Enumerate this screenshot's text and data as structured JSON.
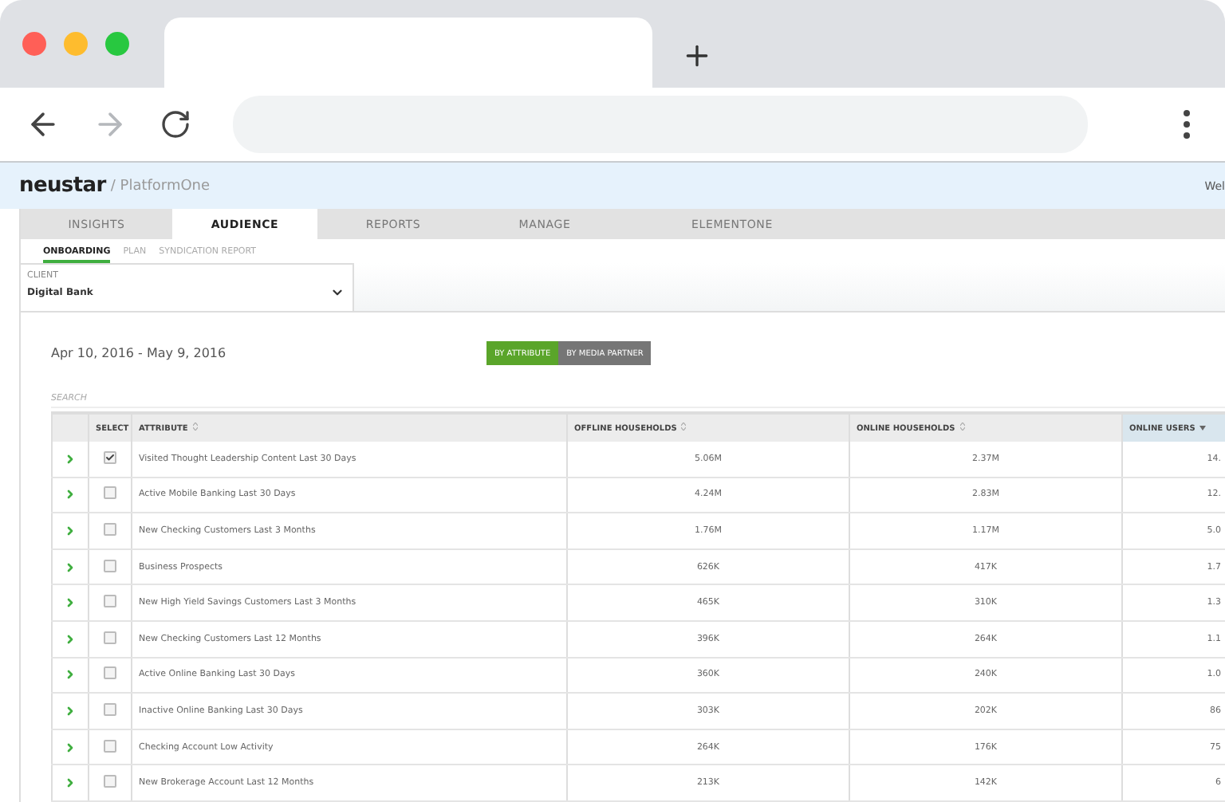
{
  "header": {
    "logo": "neustar",
    "product": "/ PlatformOne",
    "welcome": "Wel"
  },
  "tabs": [
    {
      "label": "INSIGHTS",
      "selected": false
    },
    {
      "label": "AUDIENCE",
      "selected": true
    },
    {
      "label": "REPORTS",
      "selected": false
    },
    {
      "label": "MANAGE",
      "selected": false
    },
    {
      "label": "ELEMENTONE",
      "selected": false
    }
  ],
  "subtabs": [
    {
      "label": "ONBOARDING",
      "selected": true
    },
    {
      "label": "PLAN",
      "selected": false
    },
    {
      "label": "SYNDICATION REPORT",
      "selected": false
    }
  ],
  "client": {
    "label": "CLIENT",
    "value": "Digital Bank"
  },
  "date_range": "Apr 10, 2016 - May 9, 2016",
  "view_toggle": [
    {
      "label": "BY ATTRIBUTE",
      "selected": true
    },
    {
      "label": "BY MEDIA PARTNER",
      "selected": false
    }
  ],
  "search": {
    "placeholder": "SEARCH"
  },
  "table": {
    "columns": [
      {
        "label": "SELECT",
        "sortable": false,
        "sorted": false
      },
      {
        "label": "ATTRIBUTE",
        "sortable": true,
        "sorted": false
      },
      {
        "label": "OFFLINE HOUSEHOLDS",
        "sortable": true,
        "sorted": false
      },
      {
        "label": "ONLINE HOUSEHOLDS",
        "sortable": true,
        "sorted": false
      },
      {
        "label": "ONLINE USERS",
        "sortable": true,
        "sorted": true
      }
    ],
    "rows": [
      {
        "checked": true,
        "attribute": "Visited Thought Leadership Content Last 30 Days",
        "offline": "5.06M",
        "online_households": "2.37M",
        "online_users": "14."
      },
      {
        "checked": false,
        "attribute": "Active Mobile Banking Last 30 Days",
        "offline": "4.24M",
        "online_households": "2.83M",
        "online_users": "12."
      },
      {
        "checked": false,
        "attribute": "New Checking Customers Last 3 Months",
        "offline": "1.76M",
        "online_households": "1.17M",
        "online_users": "5.0"
      },
      {
        "checked": false,
        "attribute": "Business Prospects",
        "offline": "626K",
        "online_households": "417K",
        "online_users": "1.7"
      },
      {
        "checked": false,
        "attribute": "New High Yield Savings Customers Last 3 Months",
        "offline": "465K",
        "online_households": "310K",
        "online_users": "1.3"
      },
      {
        "checked": false,
        "attribute": "New Checking Customers Last 12 Months",
        "offline": "396K",
        "online_households": "264K",
        "online_users": "1.1"
      },
      {
        "checked": false,
        "attribute": "Active Online Banking Last 30 Days",
        "offline": "360K",
        "online_households": "240K",
        "online_users": "1.0"
      },
      {
        "checked": false,
        "attribute": "Inactive Online Banking Last 30 Days",
        "offline": "303K",
        "online_households": "202K",
        "online_users": "86"
      },
      {
        "checked": false,
        "attribute": "Checking Account Low Activity",
        "offline": "264K",
        "online_households": "176K",
        "online_users": "75"
      },
      {
        "checked": false,
        "attribute": "New Brokerage Account Last 12 Months",
        "offline": "213K",
        "online_households": "142K",
        "online_users": "6"
      }
    ]
  }
}
